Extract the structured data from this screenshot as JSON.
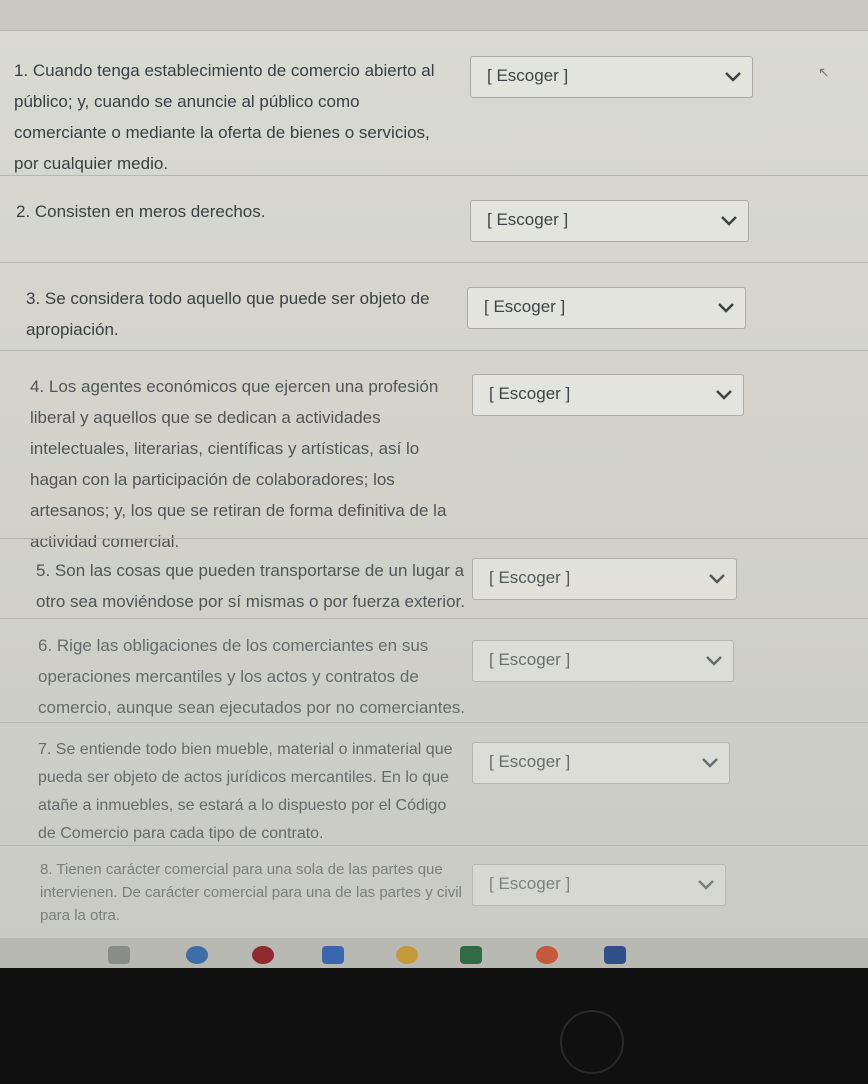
{
  "select_placeholder": "[ Escoger ]",
  "questions": [
    {
      "text": "1. Cuando tenga establecimiento de comercio abierto al público; y, cuando se anuncie al público como comerciante o mediante la oferta de bienes o servicios, por cualquier medio."
    },
    {
      "text": "2. Consisten en meros derechos."
    },
    {
      "text": "3. Se considera todo aquello que puede ser objeto de apropiación."
    },
    {
      "text": "4. Los agentes económicos que ejercen una profesión liberal y aquellos que se dedican a actividades intelectuales, literarias, científicas y artísticas, así lo hagan con la participación de colaboradores; los artesanos; y, los que se retiran de forma definitiva de la actividad comercial."
    },
    {
      "text": "5. Son las cosas que pueden transportarse de un lugar a otro sea moviéndose por sí mismas o por fuerza exterior."
    },
    {
      "text": "6. Rige las obligaciones de los comerciantes en sus operaciones mercantiles y los actos y contratos de comercio, aunque sean ejecutados por no comerciantes."
    },
    {
      "text": "7. Se entiende todo bien mueble, material o inmaterial que pueda ser objeto de actos jurídicos mercantiles. En lo que atañe a inmuebles, se estará a lo dispuesto por el Código de Comercio para cada tipo de contrato."
    },
    {
      "text": "8. Tienen carácter comercial para una sola de las partes que intervienen. De carácter comercial para una de las partes y civil para la otra."
    }
  ],
  "taskbar_icons": [
    "task-view-icon",
    "edge-icon",
    "opera-icon",
    "zoom-icon",
    "chrome-icon",
    "excel-icon",
    "chrome-icon-2",
    "word-icon"
  ]
}
